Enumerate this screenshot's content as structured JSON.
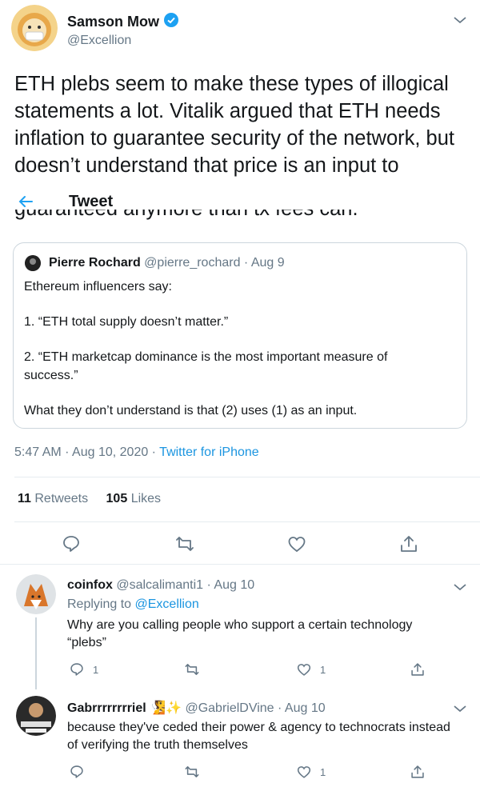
{
  "main_tweet": {
    "author_name": "Samson Mow",
    "author_handle": "@Excellion",
    "text": "ETH plebs seem to make these types of illogical statements a lot. Vitalik argued that ETH needs inflation to guarantee security of the network, but doesn’t understand that price is an input to",
    "cut_line": "guaranteed anymore than tx fees can.",
    "timestamp": "5:47 AM · Aug 10, 2020 · ",
    "source": "Twitter for iPhone",
    "retweets_count": "11",
    "retweets_label": "Retweets",
    "likes_count": "105",
    "likes_label": "Likes"
  },
  "overlay": {
    "title": "Tweet"
  },
  "quote": {
    "author_name": "Pierre Rochard",
    "author_handle": "@pierre_rochard",
    "date": "Aug 9",
    "lines": [
      "Ethereum influencers say:",
      "1. “ETH total supply doesn’t matter.”",
      "2. “ETH marketcap dominance is the most important measure of",
      "success.”",
      "What they don’t understand is that (2) uses (1) as an input."
    ]
  },
  "replies": [
    {
      "name": "coinfox",
      "handle": "@salcalimanti1",
      "date": "Aug 10",
      "replying_to_label": "Replying to ",
      "replying_to_handle": "@Excellion",
      "text": "Why are you calling people who support a certain technology “plebs”",
      "reply_count": "1",
      "retweet_count": "",
      "like_count": "1"
    },
    {
      "name": "Gabrrrrrrrriel",
      "emoji": "🧏✨",
      "handle": "@GabrielDVine",
      "date": "Aug 10",
      "text": "because they've ceded their power & agency to technocrats instead of verifying the truth themselves",
      "reply_count": "",
      "retweet_count": "",
      "like_count": "1"
    }
  ],
  "colors": {
    "accent": "#1b95e0",
    "muted": "#657786",
    "border": "#e6ecf0",
    "verified": "#1da1f2"
  },
  "icons": [
    "chevron-down-icon",
    "verified-icon",
    "back-arrow-icon",
    "reply-icon",
    "retweet-icon",
    "like-icon",
    "share-icon"
  ]
}
